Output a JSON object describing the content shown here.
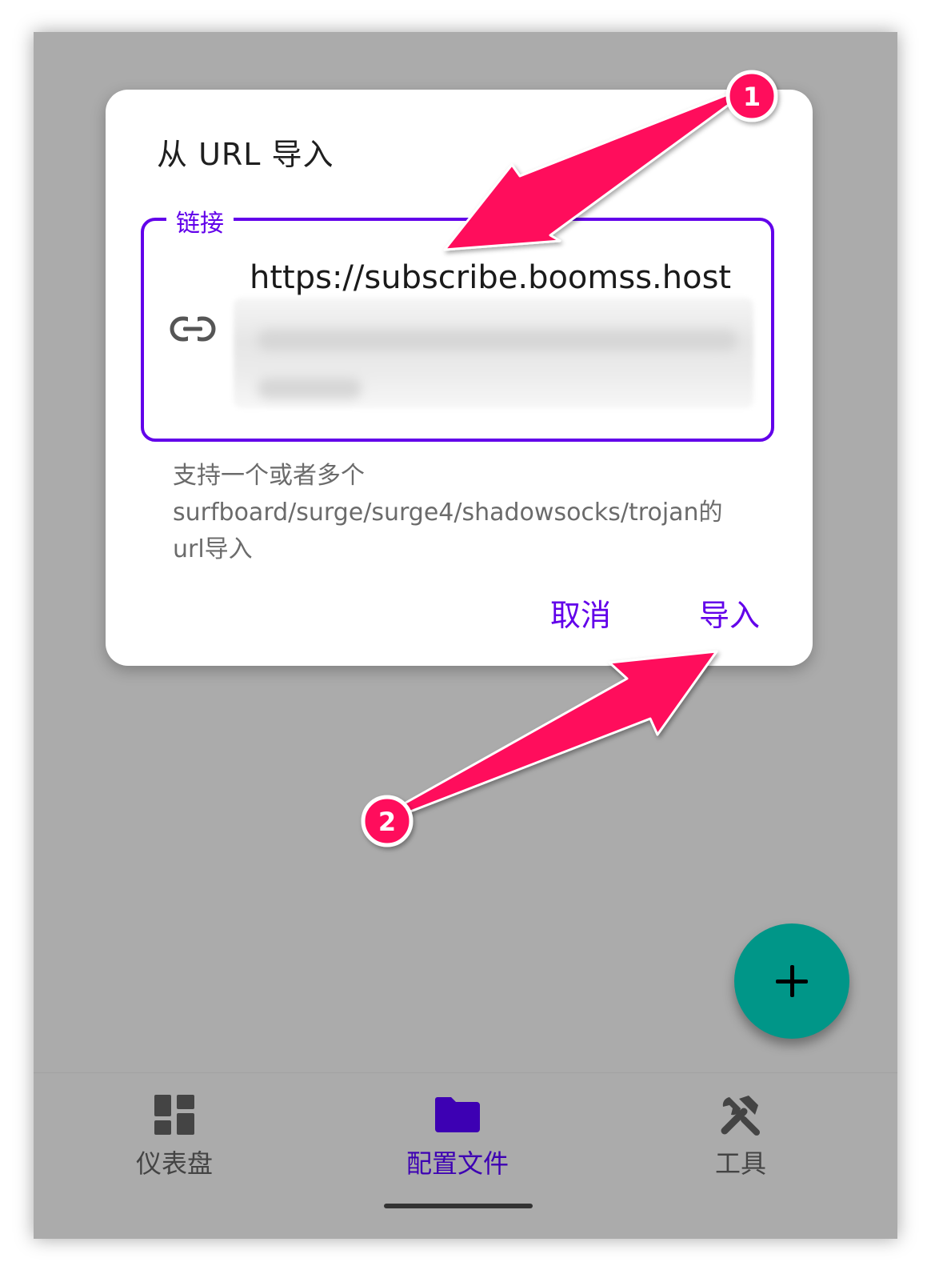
{
  "dialog": {
    "title": "从 URL 导入",
    "field": {
      "label": "链接",
      "value": "https://subscribe.boomss.host",
      "icon": "link-icon"
    },
    "helper": "支持一个或者多个surfboard/surge/surge4/shadowsocks/trojan的url导入",
    "cancel_label": "取消",
    "import_label": "导入"
  },
  "fab": {
    "icon": "plus-icon",
    "color": "#009688"
  },
  "bottom_nav": {
    "items": [
      {
        "label": "仪表盘",
        "icon": "dashboard-icon",
        "active": false
      },
      {
        "label": "配置文件",
        "icon": "folder-icon",
        "active": true
      },
      {
        "label": "工具",
        "icon": "tools-icon",
        "active": false
      }
    ]
  },
  "annotations": {
    "badges": [
      "1",
      "2"
    ],
    "color": "#ff0a5c"
  },
  "colors": {
    "accent": "#6200ea",
    "scrim": "#ababab"
  }
}
